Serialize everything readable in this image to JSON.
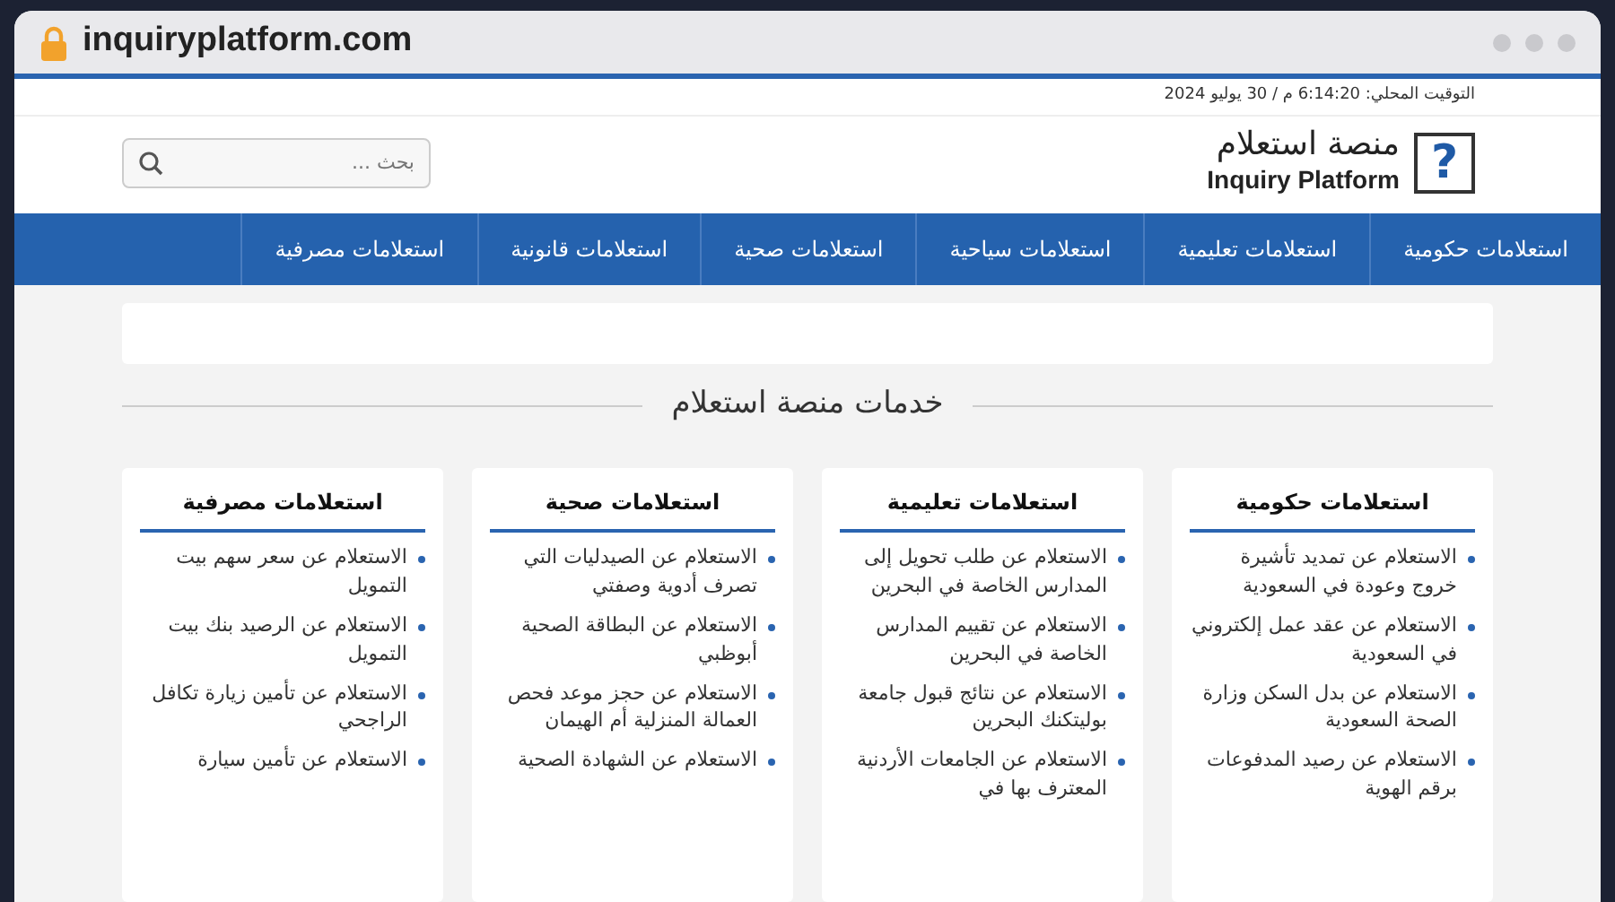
{
  "browser": {
    "url": "inquiryplatform.com"
  },
  "topbar": {
    "datetime": "التوقيت المحلي: 6:14:20 م / 30 يوليو 2024"
  },
  "logo": {
    "mark": "?",
    "title_ar": "منصة استعلام",
    "title_en": "Inquiry Platform"
  },
  "search": {
    "placeholder": "بحث ..."
  },
  "nav": [
    "استعلامات حكومية",
    "استعلامات تعليمية",
    "استعلامات سياحية",
    "استعلامات صحية",
    "استعلامات قانونية",
    "استعلامات مصرفية"
  ],
  "section_title": "خدمات منصة استعلام",
  "cards": [
    {
      "title": "استعلامات حكومية",
      "items": [
        "الاستعلام عن تمديد تأشيرة خروج وعودة في السعودية",
        "الاستعلام عن عقد عمل إلكتروني في السعودية",
        "الاستعلام عن بدل السكن وزارة الصحة السعودية",
        "الاستعلام عن رصيد المدفوعات برقم الهوية"
      ]
    },
    {
      "title": "استعلامات تعليمية",
      "items": [
        "الاستعلام عن طلب تحويل إلى المدارس الخاصة في البحرين",
        "الاستعلام عن تقييم المدارس الخاصة في البحرين",
        "الاستعلام عن نتائج قبول جامعة بوليتكنك البحرين",
        "الاستعلام عن الجامعات الأردنية المعترف بها في"
      ]
    },
    {
      "title": "استعلامات صحية",
      "items": [
        "الاستعلام عن الصيدليات التي تصرف أدوية وصفتي",
        "الاستعلام عن البطاقة الصحية أبوظبي",
        "الاستعلام عن حجز موعد فحص العمالة المنزلية أم الهيمان",
        "الاستعلام عن الشهادة الصحية"
      ]
    },
    {
      "title": "استعلامات مصرفية",
      "items": [
        "الاستعلام عن سعر سهم بيت التمويل",
        "الاستعلام عن الرصيد بنك بيت التمويل",
        "الاستعلام عن تأمين زيارة تكافل الراجحي",
        "الاستعلام عن تأمين سيارة"
      ]
    }
  ]
}
